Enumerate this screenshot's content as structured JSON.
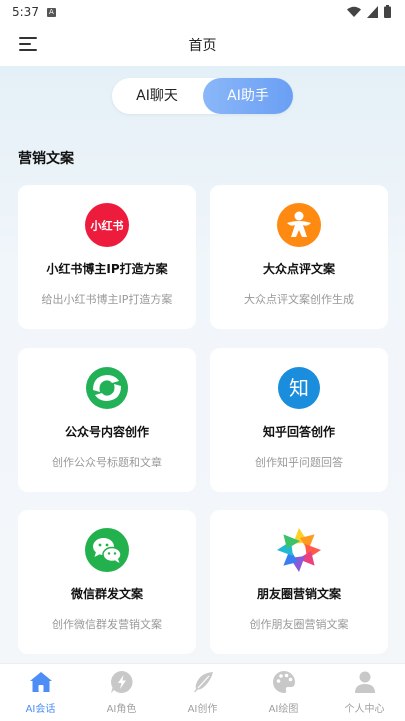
{
  "status_bar": {
    "time": "5:37",
    "notification_glyph": "A"
  },
  "header": {
    "title": "首页",
    "menu_icon": "menu-icon"
  },
  "mode_toggle": {
    "options": [
      "AI聊天",
      "AI助手"
    ],
    "selected": "AI助手",
    "active_color": "#6a9ff4"
  },
  "section": {
    "title": "营销文案"
  },
  "cards": [
    {
      "title": "小红书博主IP打造方案",
      "desc": "给出小红书博主IP打造方案",
      "icon": "xiaohongshu-icon",
      "icon_text": "小红书",
      "color": "#ee1c3c"
    },
    {
      "title": "大众点评文案",
      "desc": "大众点评文案创作生成",
      "icon": "dianping-icon",
      "color": "#ff8a12"
    },
    {
      "title": "公众号内容创作",
      "desc": "创作公众号标题和文章",
      "icon": "wechat-official-icon",
      "color": "#23b158"
    },
    {
      "title": "知乎回答创作",
      "desc": "创作知乎问题回答",
      "icon": "zhihu-icon",
      "icon_text": "知",
      "color": "#1a8ddc"
    },
    {
      "title": "微信群发文案",
      "desc": "创作微信群发营销文案",
      "icon": "wechat-icon",
      "color": "#22b14c"
    },
    {
      "title": "朋友圈营销文案",
      "desc": "创作朋友圈营销文案",
      "icon": "moments-icon",
      "color": "#ff9a1f"
    }
  ],
  "bottom_nav": {
    "items": [
      {
        "label": "AI会话",
        "icon": "home-icon",
        "active": true
      },
      {
        "label": "AI角色",
        "icon": "lightning-chat-icon",
        "active": false
      },
      {
        "label": "AI创作",
        "icon": "feather-icon",
        "active": false
      },
      {
        "label": "AI绘图",
        "icon": "palette-icon",
        "active": false
      },
      {
        "label": "个人中心",
        "icon": "person-icon",
        "active": false
      }
    ],
    "active_color": "#4d8df5",
    "inactive_color": "#c8c8c8"
  }
}
